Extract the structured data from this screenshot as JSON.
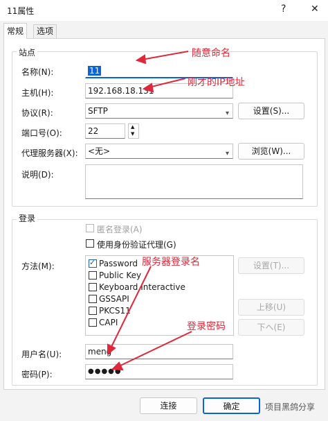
{
  "window": {
    "title": "11属性",
    "help": "?",
    "close": "✕"
  },
  "tabs": [
    {
      "label": "常规"
    },
    {
      "label": "选项"
    }
  ],
  "site": {
    "legend": "站点",
    "name_label": "名称(N):",
    "name_value": "11",
    "host_label": "主机(H):",
    "host_value": "192.168.18.131",
    "protocol_label": "协议(R):",
    "protocol_value": "SFTP",
    "settings_button": "设置(S)...",
    "port_label": "端口号(O):",
    "port_value": "22",
    "proxy_label": "代理服务器(X):",
    "proxy_value": "<无>",
    "browse_button": "浏览(W)...",
    "desc_label": "说明(D):",
    "desc_value": ""
  },
  "login": {
    "legend": "登录",
    "anonymous": "匿名登录(A)",
    "use_agent": "使用身份验证代理(G)",
    "method_label": "方法(M):",
    "methods": [
      {
        "label": "Password",
        "checked": true
      },
      {
        "label": "Public Key",
        "checked": false
      },
      {
        "label": "Keyboard Interactive",
        "checked": false
      },
      {
        "label": "GSSAPI",
        "checked": false
      },
      {
        "label": "PKCS11",
        "checked": false
      },
      {
        "label": "CAPI",
        "checked": false
      }
    ],
    "method_settings_button": "设置(T)...",
    "up_button": "上移(U)",
    "down_button": "下へ(E)",
    "user_label": "用户名(U):",
    "user_value": "meng",
    "password_label": "密码(P):",
    "password_value": "●●●●●"
  },
  "footer": {
    "connect_button": "连接",
    "ok_button": "确定"
  },
  "annotations": {
    "name_note": "随意命名",
    "host_note": "刚才的IP地址",
    "login_note": "服务器登录名",
    "password_note": "登录密码",
    "color": "#e0283a"
  },
  "watermark": {
    "text": "项目黑鸽分享"
  }
}
